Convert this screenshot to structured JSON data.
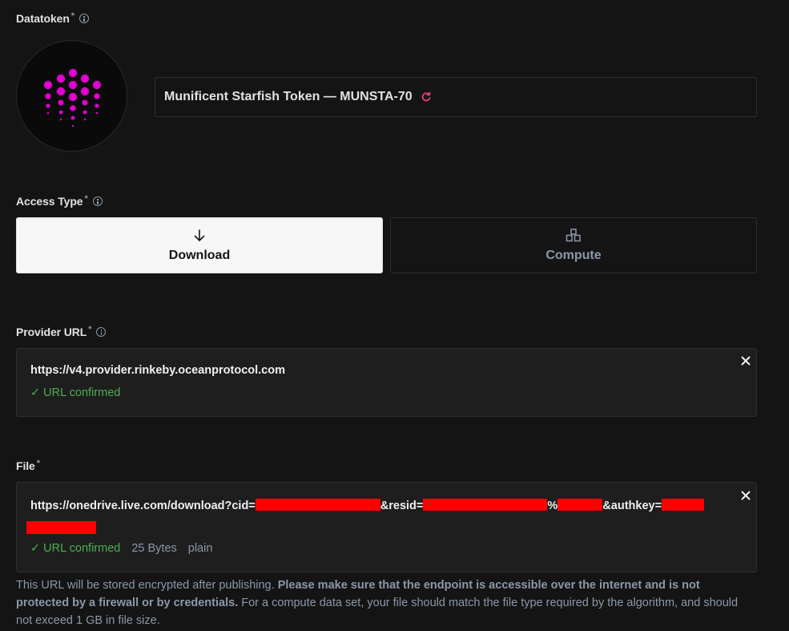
{
  "datatoken": {
    "label": "Datatoken",
    "required_mark": "*",
    "logo_color": "#e000cf",
    "name": "Munificent Starfish Token — MUNSTA-70",
    "refresh_icon": "refresh-icon"
  },
  "access_type": {
    "label": "Access Type",
    "required_mark": "*",
    "options": [
      {
        "label": "Download",
        "icon": "download-arrow-icon",
        "selected": true
      },
      {
        "label": "Compute",
        "icon": "compute-blocks-icon",
        "selected": false
      }
    ]
  },
  "provider_url": {
    "label": "Provider URL",
    "required_mark": "*",
    "value": "https://v4.provider.rinkeby.oceanprotocol.com",
    "status": "✓ URL confirmed",
    "close_icon": "close-icon"
  },
  "file": {
    "label": "File",
    "required_mark": "*",
    "url_parts": [
      "https://onedrive.live.com/download?cid=",
      "&resid=",
      "%",
      "&authkey="
    ],
    "status": "✓ URL confirmed",
    "size": "25 Bytes",
    "content_type": "plain",
    "close_icon": "close-icon"
  },
  "help": {
    "intro": "This URL will be stored encrypted after publishing. ",
    "bold": "Please make sure that the endpoint is accessible over the internet and is not protected by a firewall or by credentials.",
    "rest": " For a compute data set, your file should match the file type required by the algorithm, and should not exceed 1 GB in file size."
  },
  "colors": {
    "background": "#141414",
    "field_background": "#1e1e1e",
    "accent_pink": "#e2407c",
    "success_green": "#4caf50",
    "muted": "#8b98a9"
  }
}
